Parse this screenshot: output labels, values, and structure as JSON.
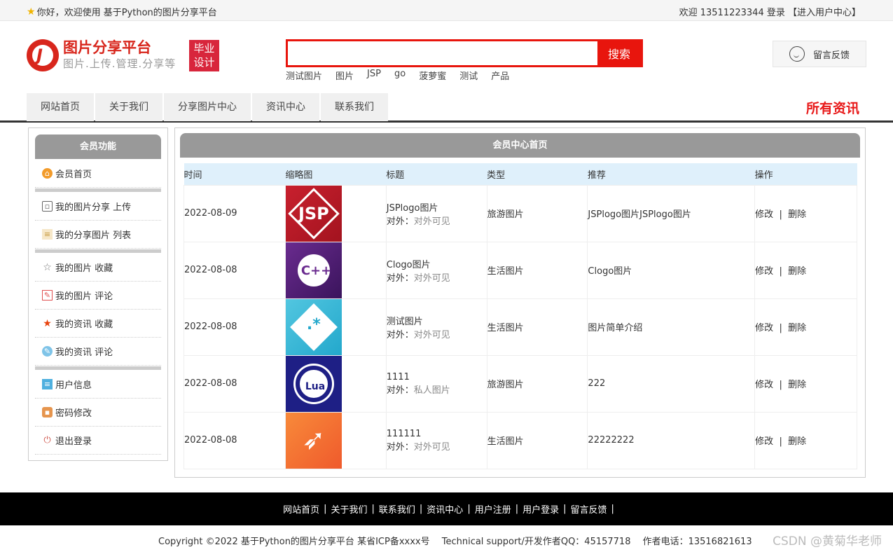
{
  "topbar": {
    "greeting": "你好，欢迎使用 基于Python的图片分享平台",
    "right": "欢迎 13511223344 登录 【进入用户中心】"
  },
  "logo": {
    "letter": "J",
    "title": "图片分享平台",
    "subtitle": "图片.上传.管理.分享等"
  },
  "badge": {
    "line1": "毕业",
    "line2": "设计"
  },
  "search": {
    "placeholder": "",
    "button": "搜索",
    "hotwords": [
      "测试图片",
      "图片",
      "JSP",
      "go",
      "菠萝蜜",
      "测试",
      "产品"
    ]
  },
  "feedback": "留言反馈",
  "nav": {
    "items": [
      "网站首页",
      "关于我们",
      "分享图片中心",
      "资讯中心",
      "联系我们"
    ],
    "allnews": "所有资讯"
  },
  "sidebar": {
    "title": "会员功能",
    "items": [
      "会员首页",
      "我的图片分享 上传",
      "我的分享图片 列表",
      "我的图片 收藏",
      "我的图片 评论",
      "我的资讯 收藏",
      "我的资讯 评论",
      "用户信息",
      "密码修改",
      "退出登录"
    ]
  },
  "main": {
    "title": "会员中心首页",
    "headers": [
      "时间",
      "缩略图",
      "标题",
      "类型",
      "推荐",
      "操作"
    ],
    "rows": [
      {
        "date": "2022-08-09",
        "thumb": "jsp",
        "title": "JSPlogo图片",
        "vis_label": "对外：",
        "vis": "对外可见",
        "type": "旅游图片",
        "rec": "JSPlogo图片JSPlogo图片",
        "edit": "修改",
        "del": "删除"
      },
      {
        "date": "2022-08-08",
        "thumb": "cpp",
        "title": "Clogo图片",
        "vis_label": "对外：",
        "vis": "对外可见",
        "type": "生活图片",
        "rec": "Clogo图片",
        "edit": "修改",
        "del": "删除"
      },
      {
        "date": "2022-08-08",
        "thumb": "regex",
        "title": "测试图片",
        "vis_label": "对外：",
        "vis": "对外可见",
        "type": "生活图片",
        "rec": "图片简单介绍",
        "edit": "修改",
        "del": "删除"
      },
      {
        "date": "2022-08-08",
        "thumb": "lua",
        "title": "1111",
        "vis_label": "对外：",
        "vis": "私人图片",
        "type": "旅游图片",
        "rec": "222",
        "edit": "修改",
        "del": "删除"
      },
      {
        "date": "2022-08-08",
        "thumb": "swift",
        "title": "111111",
        "vis_label": "对外：",
        "vis": "对外可见",
        "type": "生活图片",
        "rec": "22222222",
        "edit": "修改",
        "del": "删除"
      }
    ],
    "thumb_text": {
      "jsp": "JSP",
      "cpp": "C++",
      "regex": ".*",
      "lua": "Lua"
    }
  },
  "footer": {
    "links": [
      "网站首页",
      "关于我们",
      "联系我们",
      "资讯中心",
      "用户注册",
      "用户登录",
      "留言反馈"
    ],
    "copyright": "Copyright ©2022 基于Python的图片分享平台 某省ICP备xxxx号　 Technical support/开发作者QQ：45157718　  作者电话：13516821613",
    "watermark": "CSDN @黄菊华老师"
  }
}
